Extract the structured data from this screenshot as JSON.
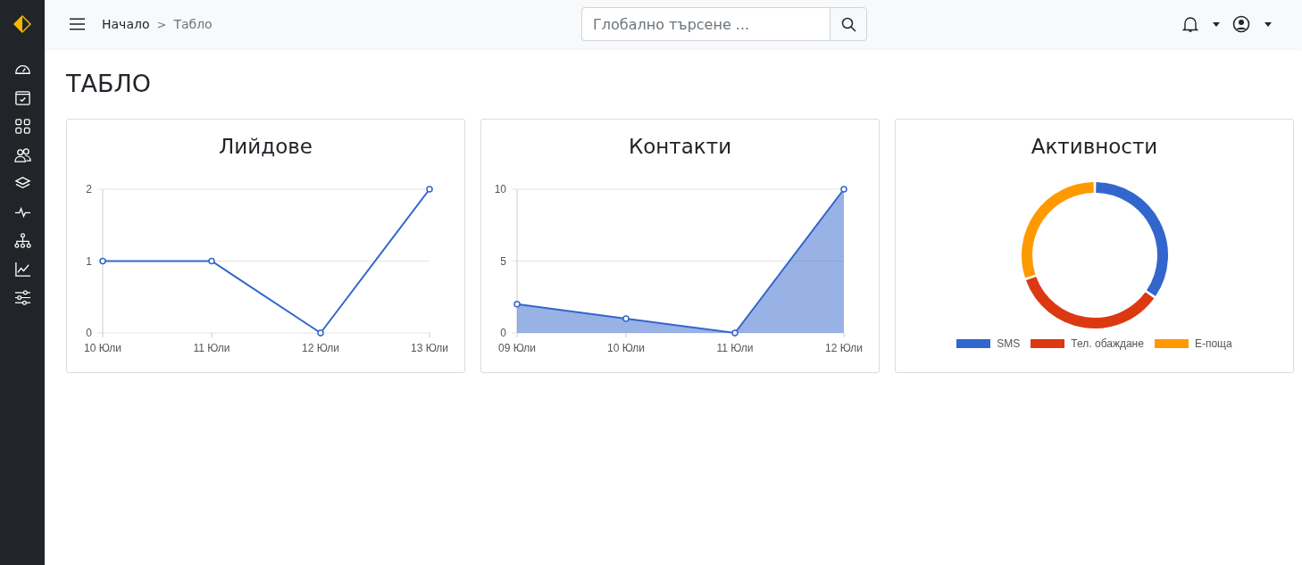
{
  "topbar": {
    "breadcrumb": [
      {
        "label": "Начало",
        "current": false
      },
      {
        "label": ">",
        "kind": "separator"
      },
      {
        "label": "Табло",
        "current": true
      }
    ],
    "search": {
      "placeholder": "Глобално търсене ..."
    }
  },
  "page_title": "ТАБЛО",
  "cards": [
    {
      "title": "Лийдове",
      "kind": "chart",
      "chart_data": {
        "type": "line",
        "categories": [
          "10 Юли",
          "11 Юли",
          "12 Юли",
          "13 Юли"
        ],
        "series": [
          {
            "color": "#3366cc",
            "marker": true,
            "values": [
              1,
              1,
              0,
              2
            ]
          }
        ],
        "ylim": [
          0,
          2
        ],
        "yticks": [
          0,
          1,
          2
        ]
      }
    },
    {
      "title": "Контакти",
      "kind": "chart",
      "chart_data": {
        "type": "area",
        "categories": [
          "09 Юли",
          "10 Юли",
          "11 Юли",
          "12 Юли"
        ],
        "series": [
          {
            "color": "#3366cc",
            "marker": true,
            "values": [
              2,
              1,
              0,
              10
            ]
          }
        ],
        "ylim": [
          0,
          10
        ],
        "yticks": [
          0,
          5,
          10
        ]
      }
    },
    {
      "title": "Активности",
      "kind": "donut",
      "legend": [
        {
          "label": "SMS",
          "color": "#3366cc"
        },
        {
          "label": "Тел. обаждане",
          "color": "#dc3912"
        },
        {
          "label": "Е-поща",
          "color": "#ff9900"
        }
      ]
    }
  ]
}
